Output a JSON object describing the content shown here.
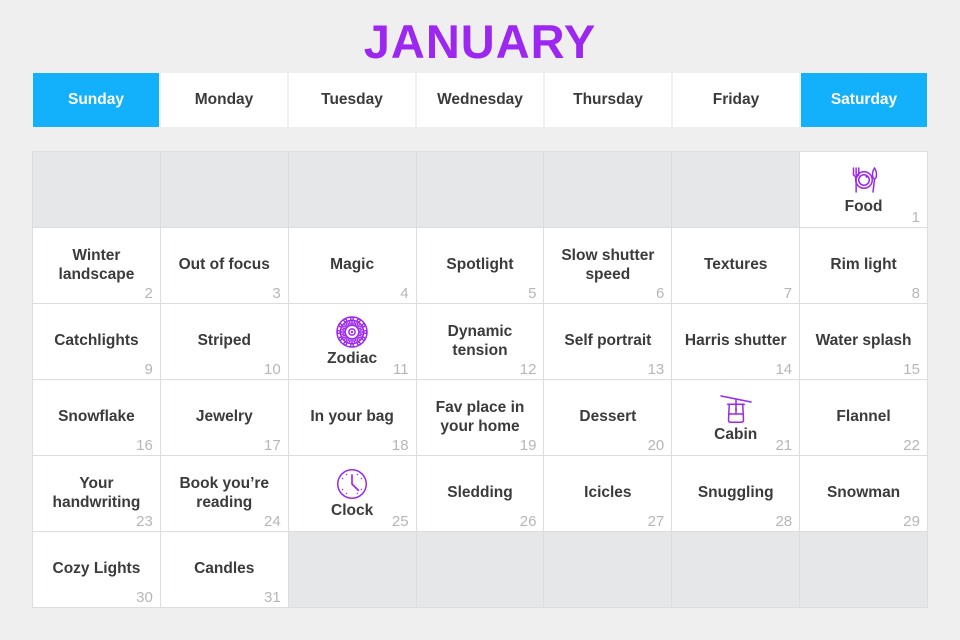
{
  "title": "JANUARY",
  "theme": {
    "title_color": "#9c27f0",
    "header_highlight_color": "#13b0fc",
    "icon_color": "#9c27f0",
    "text_color": "#3b3b3b",
    "daynum_color": "#b4b7ba",
    "empty_cell_color": "#e5e7e9",
    "page_background": "#efefef"
  },
  "weekdays": [
    {
      "label": "Sunday",
      "highlight": true
    },
    {
      "label": "Monday",
      "highlight": false
    },
    {
      "label": "Tuesday",
      "highlight": false
    },
    {
      "label": "Wednesday",
      "highlight": false
    },
    {
      "label": "Thursday",
      "highlight": false
    },
    {
      "label": "Friday",
      "highlight": false
    },
    {
      "label": "Saturday",
      "highlight": true
    }
  ],
  "cells": [
    {
      "empty": true
    },
    {
      "empty": true
    },
    {
      "empty": true
    },
    {
      "empty": true
    },
    {
      "empty": true
    },
    {
      "empty": true
    },
    {
      "day": "1",
      "label": "Food",
      "icon": "plate-fork-knife-icon"
    },
    {
      "day": "2",
      "label": "Winter landscape"
    },
    {
      "day": "3",
      "label": "Out of focus"
    },
    {
      "day": "4",
      "label": "Magic"
    },
    {
      "day": "5",
      "label": "Spotlight"
    },
    {
      "day": "6",
      "label": "Slow shutter speed"
    },
    {
      "day": "7",
      "label": "Textures"
    },
    {
      "day": "8",
      "label": "Rim light"
    },
    {
      "day": "9",
      "label": "Catchlights"
    },
    {
      "day": "10",
      "label": "Striped"
    },
    {
      "day": "11",
      "label": "Zodiac",
      "icon": "zodiac-wheel-icon"
    },
    {
      "day": "12",
      "label": "Dynamic tension"
    },
    {
      "day": "13",
      "label": "Self portrait"
    },
    {
      "day": "14",
      "label": "Harris shutter"
    },
    {
      "day": "15",
      "label": "Water splash"
    },
    {
      "day": "16",
      "label": "Snowflake"
    },
    {
      "day": "17",
      "label": "Jewelry"
    },
    {
      "day": "18",
      "label": "In your bag"
    },
    {
      "day": "19",
      "label": "Fav place in your home"
    },
    {
      "day": "20",
      "label": "Dessert"
    },
    {
      "day": "21",
      "label": "Cabin",
      "icon": "cable-car-icon"
    },
    {
      "day": "22",
      "label": "Flannel"
    },
    {
      "day": "23",
      "label": "Your handwriting"
    },
    {
      "day": "24",
      "label": "Book you’re reading"
    },
    {
      "day": "25",
      "label": "Clock",
      "icon": "clock-icon"
    },
    {
      "day": "26",
      "label": "Sledding"
    },
    {
      "day": "27",
      "label": "Icicles"
    },
    {
      "day": "28",
      "label": "Snuggling"
    },
    {
      "day": "29",
      "label": "Snowman"
    },
    {
      "day": "30",
      "label": "Cozy Lights"
    },
    {
      "day": "31",
      "label": "Candles"
    },
    {
      "empty": true
    },
    {
      "empty": true
    },
    {
      "empty": true
    },
    {
      "empty": true
    },
    {
      "empty": true
    }
  ]
}
